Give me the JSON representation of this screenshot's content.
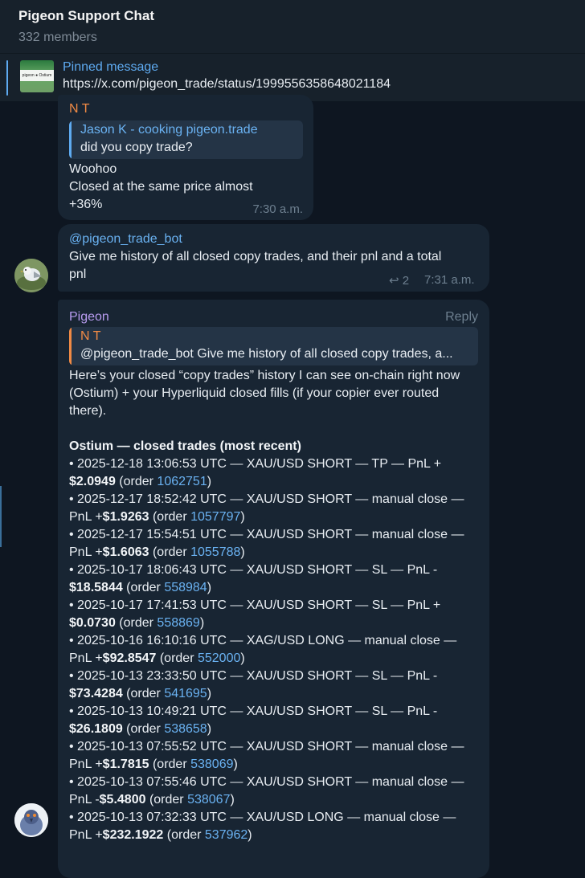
{
  "header": {
    "title": "Pigeon Support Chat",
    "members": "332 members"
  },
  "pinned": {
    "label": "Pinned message",
    "text": "https://x.com/pigeon_trade/status/1999556358648021184",
    "thumb_caption": "pigeon ● Ostium"
  },
  "messages": {
    "m1": {
      "sender": "N T",
      "reply_name": "Jason K - cooking pigeon.trade",
      "reply_text": "did you copy trade?",
      "lines": [
        "Woohoo",
        "Closed at the same price almost",
        "+36%"
      ],
      "time": "7:30 a.m."
    },
    "m2": {
      "mention": "@pigeon_trade_bot",
      "lines": [
        "Give me history of all closed copy trades, and their pnl and a total",
        "pnl"
      ],
      "reply_count": "2",
      "time": "7:31 a.m."
    },
    "m3": {
      "sender": "Pigeon",
      "reply_action": "Reply",
      "quote_name": "N T",
      "quote_text": "@pigeon_trade_bot  Give me history of all closed copy trades, a...",
      "intro": [
        "Here’s your closed “copy trades” history I can see on-chain right now",
        "(Ostium) + your Hyperliquid closed fills (if your copier ever routed",
        "there)."
      ],
      "section_title": "Ostium — closed trades (most recent)",
      "trades": [
        {
          "l1": "• 2025-12-18 13:06:53 UTC — XAU/USD SHORT — TP — PnL +",
          "pre": "",
          "pnl": "$2.0949",
          "order": "1062751"
        },
        {
          "l1": "• 2025-12-17 18:52:42 UTC — XAU/USD SHORT — manual close —",
          "pre": "PnL +",
          "pnl": "$1.9263",
          "order": "1057797"
        },
        {
          "l1": "• 2025-12-17 15:54:51 UTC — XAU/USD SHORT — manual close —",
          "pre": "PnL +",
          "pnl": "$1.6063",
          "order": "1055788"
        },
        {
          "l1": "• 2025-10-17 18:06:43 UTC — XAU/USD SHORT — SL — PnL -",
          "pre": "",
          "pnl": "$18.5844",
          "order": "558984"
        },
        {
          "l1": "• 2025-10-17 17:41:53 UTC — XAU/USD SHORT — SL — PnL +",
          "pre": "",
          "pnl": "$0.0730",
          "order": "558869"
        },
        {
          "l1": "• 2025-10-16 16:10:16 UTC — XAG/USD LONG — manual close —",
          "pre": "PnL +",
          "pnl": "$92.8547",
          "order": "552000"
        },
        {
          "l1": "• 2025-10-13 23:33:50 UTC — XAU/USD SHORT — SL — PnL -",
          "pre": "",
          "pnl": "$73.4284",
          "order": "541695"
        },
        {
          "l1": "• 2025-10-13 10:49:21 UTC — XAU/USD SHORT — SL — PnL -",
          "pre": "",
          "pnl": "$26.1809",
          "order": "538658"
        },
        {
          "l1": "• 2025-10-13 07:55:52 UTC — XAU/USD SHORT — manual close —",
          "pre": "PnL +",
          "pnl": "$1.7815",
          "order": "538069"
        },
        {
          "l1": "• 2025-10-13 07:55:46 UTC — XAU/USD SHORT — manual close —",
          "pre": "PnL -",
          "pnl": "$5.4800",
          "order": "538067"
        },
        {
          "l1": "• 2025-10-13 07:32:33 UTC — XAU/USD LONG — manual close —",
          "pre": "PnL +",
          "pnl": "$232.1922",
          "order": "537962"
        }
      ],
      "order_prefix": " (order ",
      "order_suffix": ")"
    }
  },
  "colors": {
    "background": "#0e1621",
    "bubble": "#182533",
    "link": "#6ab2f2",
    "sender_nt": "#f08a45",
    "sender_pigeon": "#b89cf0"
  }
}
